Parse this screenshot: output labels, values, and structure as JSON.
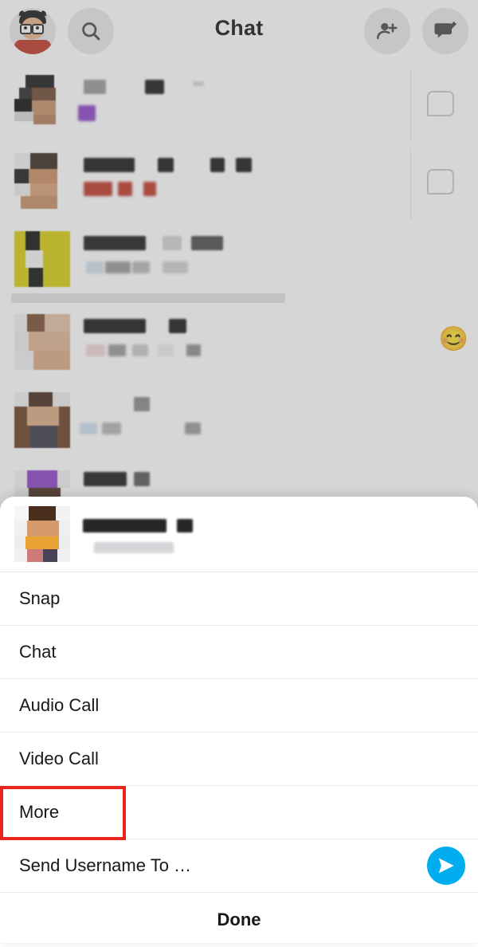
{
  "header": {
    "title": "Chat",
    "avatar_icon": "bitmoji-avatar",
    "search_icon": "search-icon",
    "add_friend_icon": "add-friend-icon",
    "new_chat_icon": "new-chat-icon"
  },
  "chat_list": {
    "rows": [
      {
        "reaction": "",
        "has_chat_icon": true
      },
      {
        "reaction": "",
        "has_chat_icon": true
      },
      {
        "reaction": "",
        "has_chat_icon": false
      },
      {
        "reaction": "😊",
        "has_chat_icon": false
      },
      {
        "reaction": "",
        "has_chat_icon": false
      },
      {
        "reaction": "",
        "has_chat_icon": false
      }
    ]
  },
  "action_sheet": {
    "items": [
      {
        "label": "Snap",
        "name": "sheet-item-snap"
      },
      {
        "label": "Chat",
        "name": "sheet-item-chat"
      },
      {
        "label": "Audio Call",
        "name": "sheet-item-audio-call"
      },
      {
        "label": "Video Call",
        "name": "sheet-item-video-call"
      },
      {
        "label": "More",
        "name": "sheet-item-more",
        "highlighted": true
      },
      {
        "label": "Send Username To …",
        "name": "sheet-item-send-username",
        "send_icon": "send-arrow-icon"
      }
    ],
    "done_label": "Done",
    "highlight_color": "#e8241c",
    "send_button_color": "#00aeef"
  }
}
